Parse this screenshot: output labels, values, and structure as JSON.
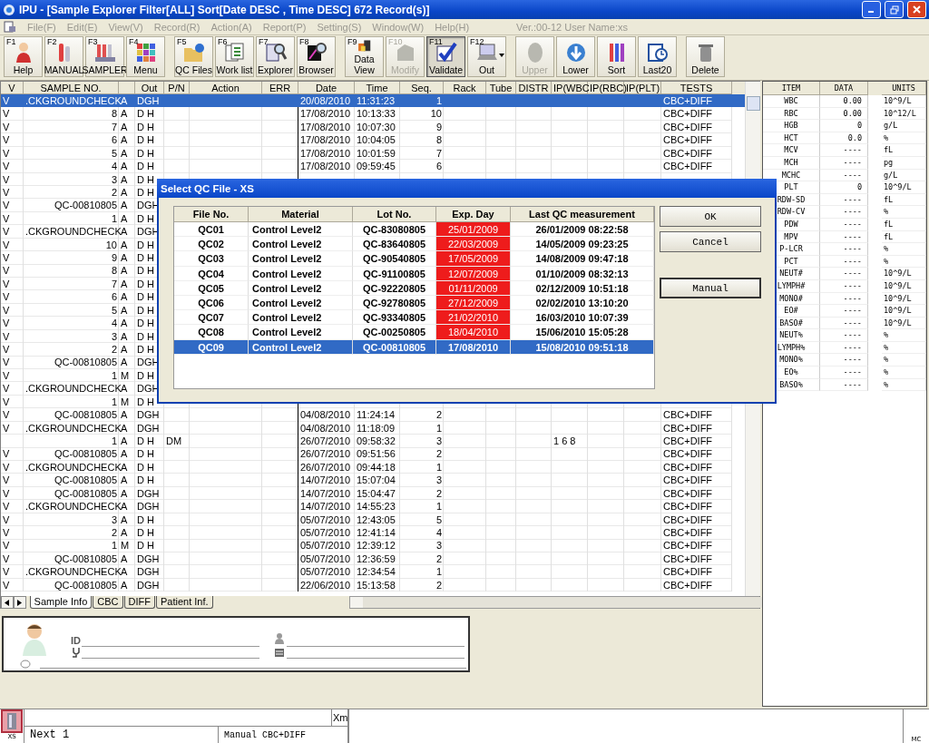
{
  "window": {
    "title": "IPU - [Sample Explorer Filter[ALL] Sort[Date DESC , Time DESC] 672 Record(s)]"
  },
  "menu": [
    {
      "label": "File(F)",
      "disabled": true
    },
    {
      "label": "Edit(E)",
      "disabled": true
    },
    {
      "label": "View(V)",
      "disabled": true
    },
    {
      "label": "Record(R)",
      "disabled": true
    },
    {
      "label": "Action(A)",
      "disabled": true
    },
    {
      "label": "Report(P)",
      "disabled": true
    },
    {
      "label": "Setting(S)",
      "disabled": true
    },
    {
      "label": "Window(W)",
      "disabled": true
    },
    {
      "label": "Help(H)",
      "disabled": true
    }
  ],
  "version_info": "Ver.:00-12 User Name:xs",
  "toolbar": [
    {
      "key": "F1",
      "label": "Help",
      "disabled": false,
      "pressed": false
    },
    {
      "key": "F2",
      "label": "MANUAL",
      "disabled": false,
      "pressed": false
    },
    {
      "key": "F3",
      "label": "SAMPLER",
      "disabled": false,
      "pressed": false
    },
    {
      "key": "F4",
      "label": "Menu",
      "disabled": false,
      "pressed": false
    },
    {
      "key": "F5",
      "label": "QC Files",
      "disabled": false,
      "pressed": false
    },
    {
      "key": "F6",
      "label": "Work list",
      "disabled": false,
      "pressed": false
    },
    {
      "key": "F7",
      "label": "Explorer",
      "disabled": false,
      "pressed": false
    },
    {
      "key": "F8",
      "label": "Browser",
      "disabled": false,
      "pressed": false
    },
    {
      "key": "F9",
      "label": "Data View",
      "disabled": false,
      "pressed": false
    },
    {
      "key": "F10",
      "label": "Modify",
      "disabled": true,
      "pressed": false
    },
    {
      "key": "F11",
      "label": "Validate",
      "disabled": false,
      "pressed": true
    },
    {
      "key": "F12",
      "label": "Out",
      "disabled": false,
      "pressed": false
    },
    {
      "label": "Upper",
      "disabled": true,
      "pressed": false
    },
    {
      "label": "Lower",
      "disabled": false,
      "pressed": false
    },
    {
      "label": "Sort",
      "disabled": false,
      "pressed": false
    },
    {
      "label": "Last20",
      "disabled": false,
      "pressed": false
    },
    {
      "label": "Delete",
      "disabled": false,
      "pressed": false
    }
  ],
  "table": {
    "columns": [
      "V",
      "SAMPLE NO.",
      "",
      "Out",
      "P/N",
      "Action",
      "ERR",
      "Date",
      "Time",
      "Seq.",
      "Rack",
      "Tube",
      "DISTR",
      "IP(WBC",
      "IP(RBC)",
      "IP(PLT)",
      "TESTS"
    ],
    "rows": [
      {
        "selected": true,
        "v": "V",
        "sample_no": ".CKGROUNDCHECK",
        "mode": "A",
        "out": "DGH",
        "date": "20/08/2010",
        "time": "11:31:23",
        "seq": "1",
        "tests": "CBC+DIFF"
      },
      {
        "selected": false,
        "v": "V",
        "sample_no": "8",
        "mode": "A",
        "out": "D H",
        "date": "17/08/2010",
        "time": "10:13:33",
        "seq": "10",
        "tests": "CBC+DIFF"
      },
      {
        "selected": false,
        "v": "V",
        "sample_no": "7",
        "mode": "A",
        "out": "D H",
        "date": "17/08/2010",
        "time": "10:07:30",
        "seq": "9",
        "tests": "CBC+DIFF"
      },
      {
        "selected": false,
        "v": "V",
        "sample_no": "6",
        "mode": "A",
        "out": "D H",
        "date": "17/08/2010",
        "time": "10:04:05",
        "seq": "8",
        "tests": "CBC+DIFF"
      },
      {
        "selected": false,
        "v": "V",
        "sample_no": "5",
        "mode": "A",
        "out": "D H",
        "date": "17/08/2010",
        "time": "10:01:59",
        "seq": "7",
        "tests": "CBC+DIFF"
      },
      {
        "selected": false,
        "v": "V",
        "sample_no": "4",
        "mode": "A",
        "out": "D H",
        "date": "17/08/2010",
        "time": "09:59:45",
        "seq": "6",
        "tests": "CBC+DIFF"
      },
      {
        "selected": false,
        "v": "V",
        "sample_no": "3",
        "mode": "A",
        "out": "D H"
      },
      {
        "selected": false,
        "v": "V",
        "sample_no": "2",
        "mode": "A",
        "out": "D H"
      },
      {
        "selected": false,
        "v": "V",
        "sample_no": "QC-00810805",
        "mode": "A",
        "out": "DGH"
      },
      {
        "selected": false,
        "v": "V",
        "sample_no": "1",
        "mode": "A",
        "out": "D H"
      },
      {
        "selected": false,
        "v": "V",
        "sample_no": ".CKGROUNDCHECK",
        "mode": "A",
        "out": "DGH"
      },
      {
        "selected": false,
        "v": "V",
        "sample_no": "10",
        "mode": "A",
        "out": "D H"
      },
      {
        "selected": false,
        "v": "V",
        "sample_no": "9",
        "mode": "A",
        "out": "D H"
      },
      {
        "selected": false,
        "v": "V",
        "sample_no": "8",
        "mode": "A",
        "out": "D H"
      },
      {
        "selected": false,
        "v": "V",
        "sample_no": "7",
        "mode": "A",
        "out": "D H"
      },
      {
        "selected": false,
        "v": "V",
        "sample_no": "6",
        "mode": "A",
        "out": "D H"
      },
      {
        "selected": false,
        "v": "V",
        "sample_no": "5",
        "mode": "A",
        "out": "D H"
      },
      {
        "selected": false,
        "v": "V",
        "sample_no": "4",
        "mode": "A",
        "out": "D H"
      },
      {
        "selected": false,
        "v": "V",
        "sample_no": "3",
        "mode": "A",
        "out": "D H"
      },
      {
        "selected": false,
        "v": "V",
        "sample_no": "2",
        "mode": "A",
        "out": "D H"
      },
      {
        "selected": false,
        "v": "V",
        "sample_no": "QC-00810805",
        "mode": "A",
        "out": "DGH"
      },
      {
        "selected": false,
        "v": "V",
        "sample_no": "1",
        "mode": "M",
        "out": "D H"
      },
      {
        "selected": false,
        "v": "V",
        "sample_no": ".CKGROUNDCHECK",
        "mode": "A",
        "out": "DGH"
      },
      {
        "selected": false,
        "v": "V",
        "sample_no": "1",
        "mode": "M",
        "out": "D H"
      },
      {
        "selected": false,
        "v": "V",
        "sample_no": "QC-00810805",
        "mode": "A",
        "out": "DGH",
        "date": "04/08/2010",
        "time": "11:24:14",
        "seq": "2",
        "tests": "CBC+DIFF"
      },
      {
        "selected": false,
        "v": "V",
        "sample_no": ".CKGROUNDCHECK",
        "mode": "A",
        "out": "DGH",
        "date": "04/08/2010",
        "time": "11:18:09",
        "seq": "1",
        "tests": "CBC+DIFF"
      },
      {
        "selected": false,
        "sample_no": "1",
        "mode": "A",
        "out": "D H",
        "pn": "DM",
        "date": "26/07/2010",
        "time": "09:58:32",
        "seq": "3",
        "ip_wbc": "1   6 8",
        "tests": "CBC+DIFF"
      },
      {
        "selected": false,
        "v": "V",
        "sample_no": "QC-00810805",
        "mode": "A",
        "out": "D H",
        "date": "26/07/2010",
        "time": "09:51:56",
        "seq": "2",
        "tests": "CBC+DIFF"
      },
      {
        "selected": false,
        "v": "V",
        "sample_no": ".CKGROUNDCHECK",
        "mode": "A",
        "out": "D H",
        "date": "26/07/2010",
        "time": "09:44:18",
        "seq": "1",
        "tests": "CBC+DIFF"
      },
      {
        "selected": false,
        "v": "V",
        "sample_no": "QC-00810805",
        "mode": "A",
        "out": "D H",
        "date": "14/07/2010",
        "time": "15:07:04",
        "seq": "3",
        "tests": "CBC+DIFF"
      },
      {
        "selected": false,
        "v": "V",
        "sample_no": "QC-00810805",
        "mode": "A",
        "out": "DGH",
        "date": "14/07/2010",
        "time": "15:04:47",
        "seq": "2",
        "tests": "CBC+DIFF"
      },
      {
        "selected": false,
        "v": "V",
        "sample_no": ".CKGROUNDCHECK",
        "mode": "A",
        "out": "DGH",
        "date": "14/07/2010",
        "time": "14:55:23",
        "seq": "1",
        "tests": "CBC+DIFF"
      },
      {
        "selected": false,
        "v": "V",
        "sample_no": "3",
        "mode": "A",
        "out": "D H",
        "date": "05/07/2010",
        "time": "12:43:05",
        "seq": "5",
        "tests": "CBC+DIFF"
      },
      {
        "selected": false,
        "v": "V",
        "sample_no": "2",
        "mode": "A",
        "out": "D H",
        "date": "05/07/2010",
        "time": "12:41:14",
        "seq": "4",
        "tests": "CBC+DIFF"
      },
      {
        "selected": false,
        "v": "V",
        "sample_no": "1",
        "mode": "M",
        "out": "D H",
        "date": "05/07/2010",
        "time": "12:39:12",
        "seq": "3",
        "tests": "CBC+DIFF"
      },
      {
        "selected": false,
        "v": "V",
        "sample_no": "QC-00810805",
        "mode": "A",
        "out": "DGH",
        "date": "05/07/2010",
        "time": "12:36:59",
        "seq": "2",
        "tests": "CBC+DIFF"
      },
      {
        "selected": false,
        "v": "V",
        "sample_no": ".CKGROUNDCHECK",
        "mode": "A",
        "out": "DGH",
        "date": "05/07/2010",
        "time": "12:34:54",
        "seq": "1",
        "tests": "CBC+DIFF"
      },
      {
        "selected": false,
        "v": "V",
        "sample_no": "QC-00810805",
        "mode": "A",
        "out": "DGH",
        "date": "22/06/2010",
        "time": "15:13:58",
        "seq": "2",
        "tests": "CBC+DIFF"
      }
    ],
    "tabs": [
      {
        "label": "Sample Info",
        "selected": true
      },
      {
        "label": "CBC",
        "selected": false
      },
      {
        "label": "DIFF",
        "selected": false
      },
      {
        "label": "Patient Inf.",
        "selected": false
      }
    ]
  },
  "dialog": {
    "title": "Select QC File - XS",
    "columns": [
      "File No.",
      "Material",
      "Lot No.",
      "Exp. Day",
      "Last QC measurement"
    ],
    "rows": [
      {
        "file_no": "QC01",
        "material": "Control Level2",
        "lot_no": "QC-83080805",
        "exp_day": "25/01/2009",
        "expired": true,
        "last_qc": "26/01/2009 08:22:58",
        "selected": false
      },
      {
        "file_no": "QC02",
        "material": "Control Level2",
        "lot_no": "QC-83640805",
        "exp_day": "22/03/2009",
        "expired": true,
        "last_qc": "14/05/2009 09:23:25",
        "selected": false
      },
      {
        "file_no": "QC03",
        "material": "Control Level2",
        "lot_no": "QC-90540805",
        "exp_day": "17/05/2009",
        "expired": true,
        "last_qc": "14/08/2009 09:47:18",
        "selected": false
      },
      {
        "file_no": "QC04",
        "material": "Control Level2",
        "lot_no": "QC-91100805",
        "exp_day": "12/07/2009",
        "expired": true,
        "last_qc": "01/10/2009 08:32:13",
        "selected": false
      },
      {
        "file_no": "QC05",
        "material": "Control Level2",
        "lot_no": "QC-92220805",
        "exp_day": "01/11/2009",
        "expired": true,
        "last_qc": "02/12/2009 10:51:18",
        "selected": false
      },
      {
        "file_no": "QC06",
        "material": "Control Level2",
        "lot_no": "QC-92780805",
        "exp_day": "27/12/2009",
        "expired": true,
        "last_qc": "02/02/2010 13:10:20",
        "selected": false
      },
      {
        "file_no": "QC07",
        "material": "Control Level2",
        "lot_no": "QC-93340805",
        "exp_day": "21/02/2010",
        "expired": true,
        "last_qc": "16/03/2010 10:07:39",
        "selected": false
      },
      {
        "file_no": "QC08",
        "material": "Control Level2",
        "lot_no": "QC-00250805",
        "exp_day": "18/04/2010",
        "expired": true,
        "last_qc": "15/06/2010 15:05:28",
        "selected": false
      },
      {
        "file_no": "QC09",
        "material": "Control Level2",
        "lot_no": "QC-00810805",
        "exp_day": "17/08/2010",
        "expired": false,
        "last_qc": "15/08/2010 09:51:18",
        "selected": true
      }
    ],
    "buttons": [
      "OK",
      "Cancel",
      "Manual"
    ]
  },
  "results": {
    "columns": [
      "ITEM",
      "DATA",
      "UNITS"
    ],
    "rows": [
      {
        "item": "WBC",
        "data": "0.00",
        "units": "10^9/L"
      },
      {
        "item": "RBC",
        "data": "0.00",
        "units": "10^12/L"
      },
      {
        "item": "HGB",
        "data": "0",
        "units": "g/L"
      },
      {
        "item": "HCT",
        "data": "0.0",
        "units": "%"
      },
      {
        "item": "MCV",
        "data": "----",
        "units": "fL"
      },
      {
        "item": "MCH",
        "data": "----",
        "units": "pg"
      },
      {
        "item": "MCHC",
        "data": "----",
        "units": "g/L"
      },
      {
        "item": "PLT",
        "data": "0",
        "units": "10^9/L"
      },
      {
        "item": "RDW-SD",
        "data": "----",
        "units": "fL"
      },
      {
        "item": "RDW-CV",
        "data": "----",
        "units": "%"
      },
      {
        "item": "PDW",
        "data": "----",
        "units": "fL"
      },
      {
        "item": "MPV",
        "data": "----",
        "units": "fL"
      },
      {
        "item": "P-LCR",
        "data": "----",
        "units": "%"
      },
      {
        "item": "PCT",
        "data": "----",
        "units": "%"
      },
      {
        "item": "NEUT#",
        "data": "----",
        "units": "10^9/L"
      },
      {
        "item": "LYMPH#",
        "data": "----",
        "units": "10^9/L"
      },
      {
        "item": "MONO#",
        "data": "----",
        "units": "10^9/L"
      },
      {
        "item": "EO#",
        "data": "----",
        "units": "10^9/L"
      },
      {
        "item": "BASO#",
        "data": "----",
        "units": "10^9/L"
      },
      {
        "item": "NEUT%",
        "data": "----",
        "units": "%"
      },
      {
        "item": "LYMPH%",
        "data": "----",
        "units": "%"
      },
      {
        "item": "MONO%",
        "data": "----",
        "units": "%"
      },
      {
        "item": "EO%",
        "data": "----",
        "units": "%"
      },
      {
        "item": "BASO%",
        "data": "----",
        "units": "%"
      }
    ]
  },
  "patient": {
    "id_label": "ID"
  },
  "status_bar": {
    "instrument": "XS",
    "unit": "Xm",
    "next": "Next 1",
    "mode": "Manual CBC+DIFF",
    "corner": "MC"
  }
}
